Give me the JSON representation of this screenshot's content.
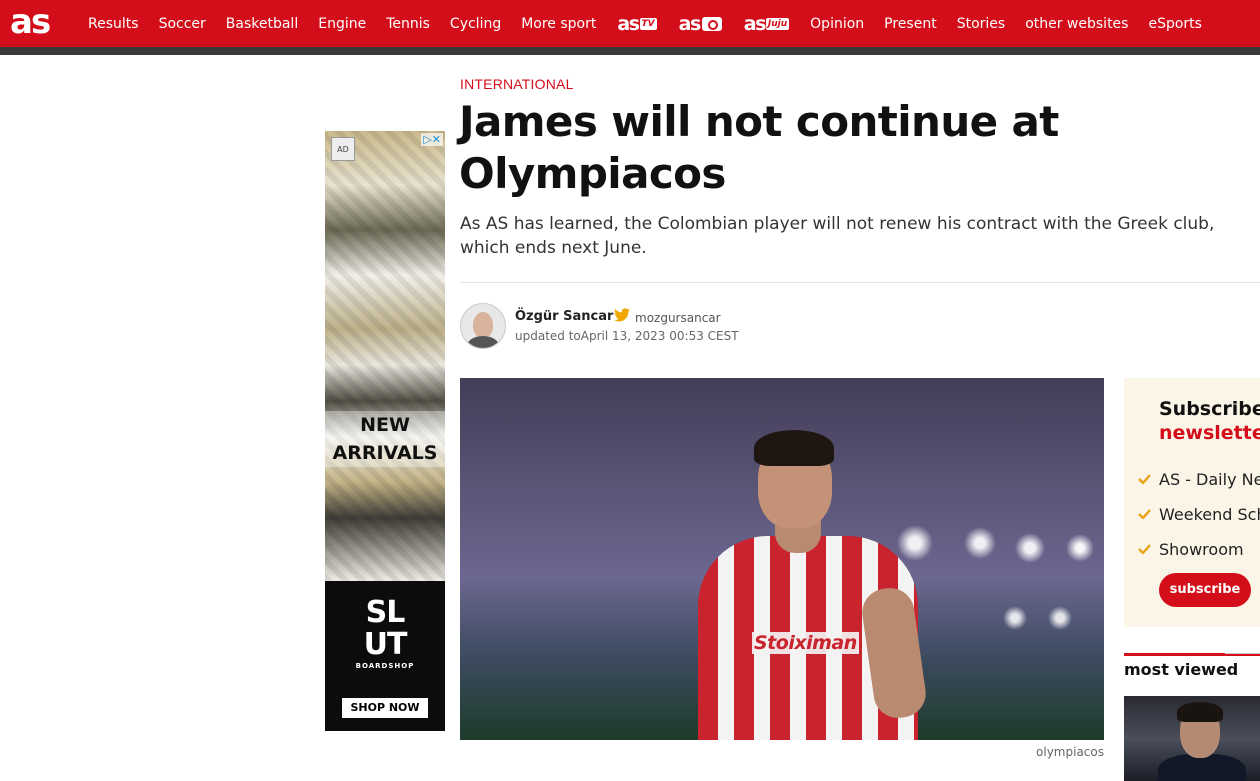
{
  "brand": {
    "logo": "as",
    "accent_color": "#d40d1a"
  },
  "nav": {
    "items_left": [
      "Results",
      "Soccer",
      "Basketball",
      "Engine",
      "Tennis",
      "Cycling",
      "More sport"
    ],
    "brands": [
      {
        "word": "as",
        "tag": "TV"
      },
      {
        "word": "as",
        "icon": "camera-icon"
      },
      {
        "word": "as",
        "tag": "Juju"
      }
    ],
    "items_right": [
      "Opinion",
      "Present",
      "Stories",
      "other websites",
      "eSports"
    ]
  },
  "ad": {
    "badge": "AD",
    "choices": "▷✕",
    "headline_line1": "NEW",
    "headline_line2": "ARRIVALS",
    "logo_line1": "SL",
    "logo_line2": "UT",
    "logo_sub": "BOARDSHOP",
    "cta": "SHOP NOW"
  },
  "article": {
    "section": "INTERNATIONAL",
    "headline": "James will not continue at Olympiacos",
    "subheadline": "As AS has learned, the Colombian player will not renew his contract with the Greek club, which ends next June.",
    "author": {
      "name": "Özgür Sancar",
      "twitter_handle": "mozgursancar",
      "updated": "updated toApril 13, 2023 00:53 CEST"
    },
    "photo": {
      "sponsor_text": "Stoiximan",
      "caption": "olympiacos"
    }
  },
  "sidebar": {
    "newsletter": {
      "title_line1": "Subscribe to",
      "title_line2": "newsletters",
      "items": [
        "AS - Daily News",
        "Weekend Schedule",
        "Showroom"
      ],
      "button": "subscribe"
    },
    "most_viewed": {
      "title": "most viewed"
    }
  }
}
